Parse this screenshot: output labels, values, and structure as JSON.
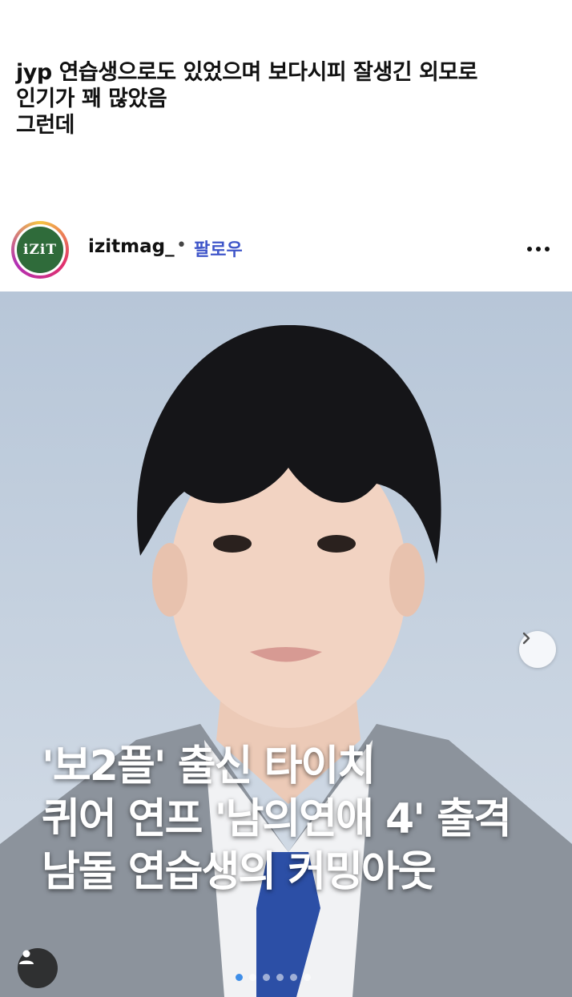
{
  "caption": {
    "lines": [
      "jyp 연습생으로도 있었으며 보다시피 잘생긴 외모로",
      "인기가 꽤 많았음",
      "그런데"
    ]
  },
  "post": {
    "avatar_text": "iZiT",
    "username": "izitmag_",
    "separator": "•",
    "follow_label": "팔로우",
    "more_icon": "more-horizontal-icon",
    "headline_lines": [
      "'보2플' 출신 타이치",
      "퀴어 연프 '남의연애 4' 출격",
      "남돌 연습생의 커밍아웃"
    ],
    "carousel": {
      "current": 1,
      "total": 6
    },
    "colors": {
      "follow": "#3f56c9",
      "avatar_bg": "#2f6b3a",
      "active_dot": "#3f8ee8"
    }
  }
}
